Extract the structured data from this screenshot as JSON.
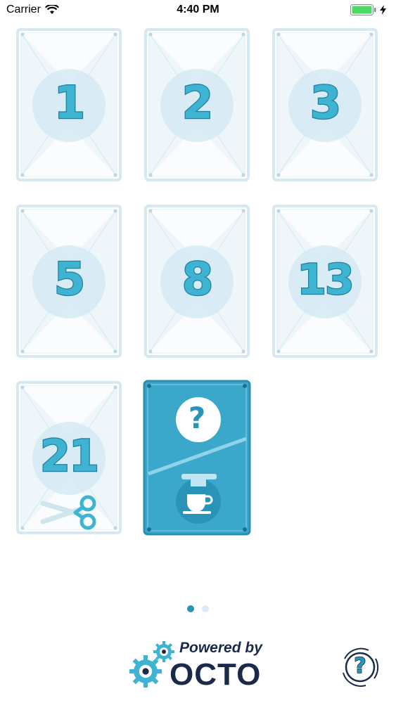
{
  "status_bar": {
    "carrier": "Carrier",
    "time": "4:40 PM"
  },
  "cards": [
    {
      "label": "1"
    },
    {
      "label": "2"
    },
    {
      "label": "3"
    },
    {
      "label": "5"
    },
    {
      "label": "8"
    },
    {
      "label": "13"
    },
    {
      "label": "21"
    },
    {
      "label": "?"
    }
  ],
  "special_card": {
    "question_symbol": "?",
    "icon": "coffee-cup-icon"
  },
  "page_indicator": {
    "pages": 2,
    "current": 1
  },
  "footer": {
    "powered_by": "Powered by",
    "brand": "OCTO",
    "help_symbol": "?"
  },
  "colors": {
    "accent": "#3fb4d2",
    "accent_dark": "#1f7f9f",
    "card_border": "#d6e9f2",
    "card_fill": "#eef6fa",
    "brand_text": "#1b2a4a"
  }
}
